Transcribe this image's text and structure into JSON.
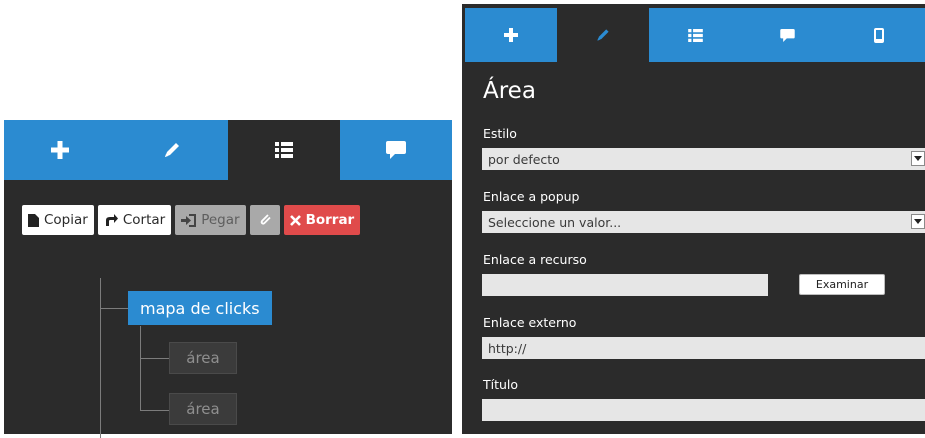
{
  "left_panel": {
    "tabs": [
      {
        "icon": "plus-icon"
      },
      {
        "icon": "pencil-icon"
      },
      {
        "icon": "list-icon",
        "active": true
      },
      {
        "icon": "comment-icon"
      }
    ],
    "toolbar": {
      "copy_label": "Copiar",
      "cut_label": "Cortar",
      "paste_label": "Pegar",
      "delete_label": "Borrar"
    },
    "tree": {
      "root": "mapa de clicks",
      "children": [
        "área",
        "área"
      ]
    }
  },
  "right_panel": {
    "tabs": [
      {
        "icon": "plus-icon"
      },
      {
        "icon": "pencil-icon",
        "active": true
      },
      {
        "icon": "list-icon"
      },
      {
        "icon": "comment-icon"
      },
      {
        "icon": "mobile-icon"
      }
    ],
    "title": "Área",
    "fields": {
      "estilo_label": "Estilo",
      "estilo_value": "por defecto",
      "popup_label": "Enlace a popup",
      "popup_value": "Seleccione un valor...",
      "recurso_label": "Enlace a recurso",
      "recurso_value": "",
      "examinar_label": "Examinar",
      "externo_label": "Enlace externo",
      "externo_value": "http://",
      "titulo_label": "Título",
      "titulo_value": ""
    }
  },
  "colors": {
    "accent": "#2b8bd1",
    "panel_bg": "#2b2b2b",
    "danger": "#e04b4b"
  }
}
